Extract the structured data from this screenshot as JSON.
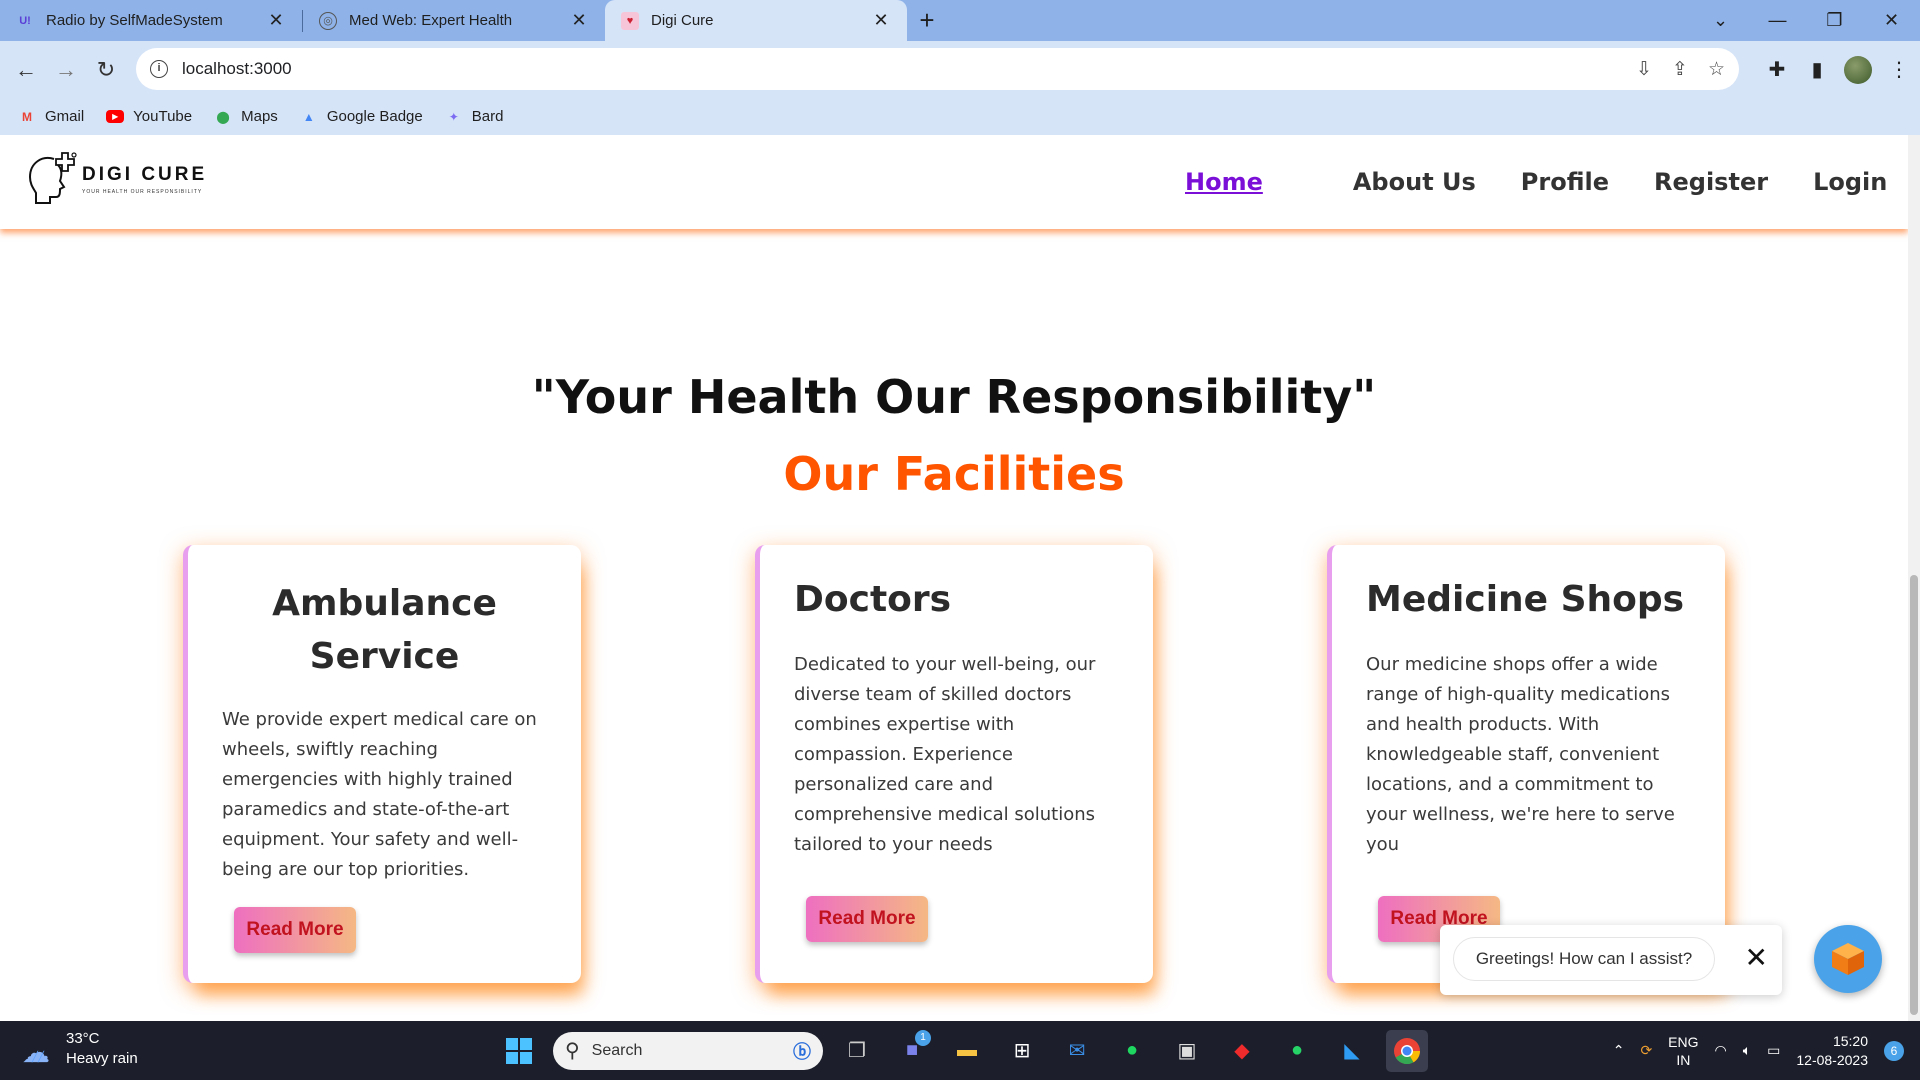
{
  "browser": {
    "tabs": [
      {
        "title": "Radio by SelfMadeSystem",
        "favicon": "U!"
      },
      {
        "title": "Med Web: Expert Health",
        "favicon": "gpt-icon"
      },
      {
        "title": "Digi Cure",
        "favicon": "digicure-icon"
      }
    ],
    "active_tab": 2,
    "url": "localhost:3000",
    "bookmarks": [
      {
        "label": "Gmail",
        "icon": "gmail-icon"
      },
      {
        "label": "YouTube",
        "icon": "youtube-icon"
      },
      {
        "label": "Maps",
        "icon": "maps-icon"
      },
      {
        "label": "Google Badge",
        "icon": "google-badge-icon"
      },
      {
        "label": "Bard",
        "icon": "bard-icon"
      }
    ]
  },
  "site": {
    "logo": {
      "name": "DIGI CURE",
      "tagline": "YOUR HEALTH OUR RESPONSIBILITY"
    },
    "nav": [
      {
        "label": "Home"
      },
      {
        "label": "About Us"
      },
      {
        "label": "Profile"
      },
      {
        "label": "Register"
      },
      {
        "label": "Login"
      }
    ],
    "headline": "\"Your Health Our Responsibility\"",
    "subheadline": "Our Facilities",
    "cards": [
      {
        "title": "Ambulance Service",
        "text": "We provide expert medical care on wheels, swiftly reaching emergencies with highly trained paramedics and state-of-the-art equipment. Your safety and well-being are our top priorities.",
        "button": "Read More"
      },
      {
        "title": "Doctors",
        "text": "Dedicated to your well-being, our diverse team of skilled doctors combines expertise with compassion. Experience personalized care and comprehensive medical solutions tailored to your needs",
        "button": "Read More"
      },
      {
        "title": "Medicine Shops",
        "text": "Our medicine shops offer a wide range of high-quality medications and health products. With knowledgeable staff, convenient locations, and a commitment to your wellness, we're here to serve you",
        "button": "Read More"
      }
    ],
    "chat": {
      "greeting": "Greetings! How can I assist?"
    }
  },
  "taskbar": {
    "weather": {
      "temp": "33°C",
      "condition": "Heavy rain"
    },
    "search_label": "Search",
    "teams_badge": "1",
    "lang": {
      "line1": "ENG",
      "line2": "IN"
    },
    "time": "15:20",
    "date": "12-08-2023",
    "notifications": "6"
  },
  "colors": {
    "accent_orange": "#ff5500",
    "nav_active": "#7b0fd8",
    "button_text": "#c1121f"
  }
}
